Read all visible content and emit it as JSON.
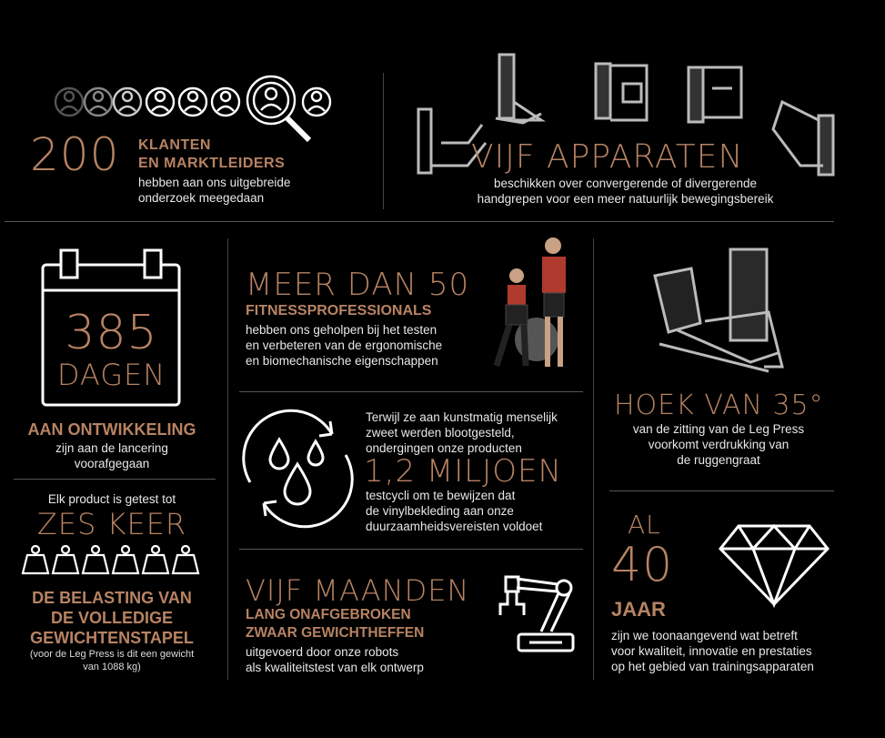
{
  "colors": {
    "accent": "#b78363",
    "background": "#000000",
    "text": "#ffffff",
    "divider": "#555555"
  },
  "clients": {
    "number": "200",
    "line1": "KLANTEN",
    "line2": "EN MARKTLEIDERS",
    "desc1": "hebben aan ons uitgebreide",
    "desc2": "onderzoek meegedaan",
    "icon": "people-magnifier-icon"
  },
  "machines": {
    "title": "VIJF APPARATEN",
    "desc1": "beschikken over convergerende of divergerende",
    "desc2": "handgrepen voor een meer natuurlijk bewegingsbereik",
    "icon": "gym-machines-image"
  },
  "days": {
    "number": "385",
    "unit": "DAGEN",
    "label": "AAN ONTWIKKELING",
    "desc1": "zijn aan de lancering",
    "desc2": "voorafgegaan",
    "icon": "calendar-icon"
  },
  "professionals": {
    "title": "MEER DAN 50",
    "subtitle": "FITNESSPROFESSIONALS",
    "desc1": "hebben ons geholpen bij het testen",
    "desc2": "en verbeteren van de ergonomische",
    "desc3": "en biomechanische eigenschappen",
    "icon": "trainers-photo"
  },
  "angle": {
    "title": "HOEK VAN 35°",
    "desc1": "van de zitting van de Leg Press",
    "desc2": "voorkomt verdrukking van",
    "desc3": "de ruggengraat",
    "icon": "leg-press-image"
  },
  "sweat": {
    "intro1": "Terwijl ze aan kunstmatig menselijk",
    "intro2": "zweet werden blootgesteld,",
    "intro3": "ondergingen onze producten",
    "number": "1,2 MILJOEN",
    "desc1": "testcycli om te bewijzen dat",
    "desc2": "de vinylbekleding aan onze",
    "desc3": "duurzaamheidsvereisten voldoet",
    "icon": "sweat-drops-icon"
  },
  "times": {
    "intro": "Elk product is getest tot",
    "title": "ZES KEER",
    "label1": "DE BELASTING VAN",
    "label2": "DE VOLLEDIGE",
    "label3": "GEWICHTENSTAPEL",
    "note1": "(voor de Leg Press is dit een gewicht",
    "note2": "van 1088 kg)",
    "icon": "weights-icon"
  },
  "months": {
    "title": "VIJF MAANDEN",
    "sub1": "LANG ONAFGEBROKEN",
    "sub2": "ZWAAR GEWICHTHEFFEN",
    "desc1": "uitgevoerd door onze robots",
    "desc2": "als kwaliteitstest van elk ontwerp",
    "icon": "robot-arm-icon"
  },
  "years": {
    "prefix": "AL",
    "number": "40",
    "unit": "JAAR",
    "desc1": "zijn we toonaangevend wat betreft",
    "desc2": "voor kwaliteit, innovatie en prestaties",
    "desc3": "op het gebied van trainingsapparaten",
    "icon": "diamond-icon"
  }
}
